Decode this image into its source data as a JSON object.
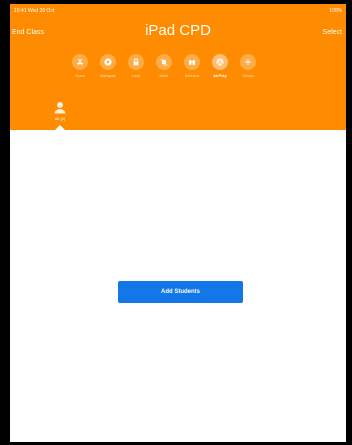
{
  "status_bar": {
    "left": "10:41 Wed 28 Oct",
    "right": "100%"
  },
  "nav": {
    "left_button": "End Class",
    "title": "iPad CPD",
    "right_button": "Select"
  },
  "actions": [
    {
      "label": "Open",
      "icon": "app-store-icon",
      "active": false
    },
    {
      "label": "Navigate",
      "icon": "compass-icon",
      "active": false
    },
    {
      "label": "Lock",
      "icon": "lock-icon",
      "active": false
    },
    {
      "label": "Mute",
      "icon": "mute-icon",
      "active": false
    },
    {
      "label": "Screens",
      "icon": "binoculars-icon",
      "active": false
    },
    {
      "label": "AirPlay",
      "icon": "airplay-icon",
      "active": true
    },
    {
      "label": "Group",
      "icon": "plus-icon",
      "active": false
    }
  ],
  "group": {
    "label": "All (0)",
    "icon": "person-icon"
  },
  "main": {
    "add_students_label": "Add Students"
  },
  "colors": {
    "header": "#FF8C00",
    "button": "#1477E8",
    "frame": "#000000"
  }
}
